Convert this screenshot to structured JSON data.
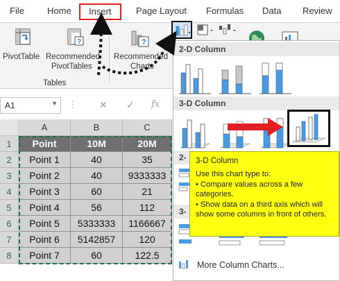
{
  "ribbon_tabs": [
    "File",
    "Home",
    "Insert",
    "Page Layout",
    "Formulas",
    "Data",
    "Review"
  ],
  "ribbon": {
    "pivot_table": "PivotTable",
    "recommended_pivot_line1": "Recommended",
    "recommended_pivot_line2": "PivotTables",
    "recommended_charts_line1": "Recommended",
    "recommended_charts_line2": "Charts",
    "group_tables": "Tables"
  },
  "formula_bar": {
    "name_box": "A1",
    "fx": "fx"
  },
  "columns": [
    "A",
    "B",
    "C"
  ],
  "rows": [
    "1",
    "2",
    "3",
    "4",
    "5",
    "6",
    "7",
    "8"
  ],
  "table": {
    "headers": [
      "Point",
      "10M",
      "20M"
    ],
    "rows": [
      [
        "Point 1",
        "40",
        "35"
      ],
      [
        "Point 2",
        "40",
        "9333333"
      ],
      [
        "Point 3",
        "60",
        "21"
      ],
      [
        "Point 4",
        "56",
        "112"
      ],
      [
        "Point 5",
        "5333333",
        "1166667"
      ],
      [
        "Point 6",
        "5142857",
        "120"
      ],
      [
        "Point 7",
        "60",
        "122.5"
      ]
    ]
  },
  "dropdown": {
    "section_2d": "2-D Column",
    "section_3d": "3-D Column",
    "section_2d_bar_partial": "2-",
    "section_3d_bar_partial": "3-",
    "more": "More Column Charts..."
  },
  "tooltip": {
    "title": "3-D Column",
    "intro": "Use this chart type to:",
    "bullet1": "• Compare values across a few categories.",
    "bullet2": "• Show data on a third axis which will show some columns in front of others."
  },
  "colors": {
    "accent_red": "#e02020",
    "excel_green": "#1f7244",
    "tooltip_yellow": "#ffff12",
    "chart_blue": "#4a9be0"
  }
}
